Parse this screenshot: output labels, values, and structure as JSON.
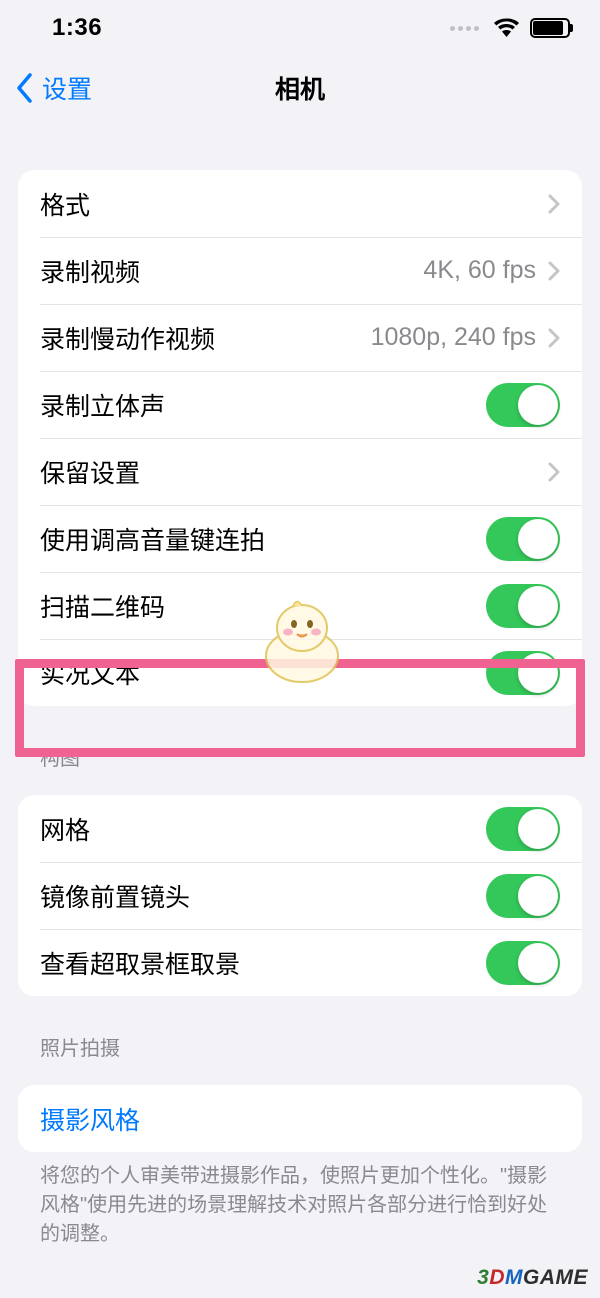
{
  "statusBar": {
    "time": "1:36"
  },
  "nav": {
    "back": "设置",
    "title": "相机"
  },
  "group1": {
    "formats": {
      "label": "格式"
    },
    "recordVideo": {
      "label": "录制视频",
      "value": "4K, 60 fps"
    },
    "recordSlomo": {
      "label": "录制慢动作视频",
      "value": "1080p, 240 fps"
    },
    "stereo": {
      "label": "录制立体声"
    },
    "preserve": {
      "label": "保留设置"
    },
    "volumeBurst": {
      "label": "使用调高音量键连拍"
    },
    "scanQR": {
      "label": "扫描二维码"
    },
    "liveText": {
      "label": "实况文本"
    }
  },
  "group2": {
    "header": "构图",
    "grid": {
      "label": "网格"
    },
    "mirrorFront": {
      "label": "镜像前置镜头"
    },
    "viewOutside": {
      "label": "查看超取景框取景"
    }
  },
  "group3": {
    "header": "照片拍摄",
    "photoStyles": {
      "label": "摄影风格"
    },
    "footer": "将您的个人审美带进摄影作品，使照片更加个性化。\"摄影风格\"使用先进的场景理解技术对照片各部分进行恰到好处的调整。"
  },
  "watermark": "3DMGAME"
}
